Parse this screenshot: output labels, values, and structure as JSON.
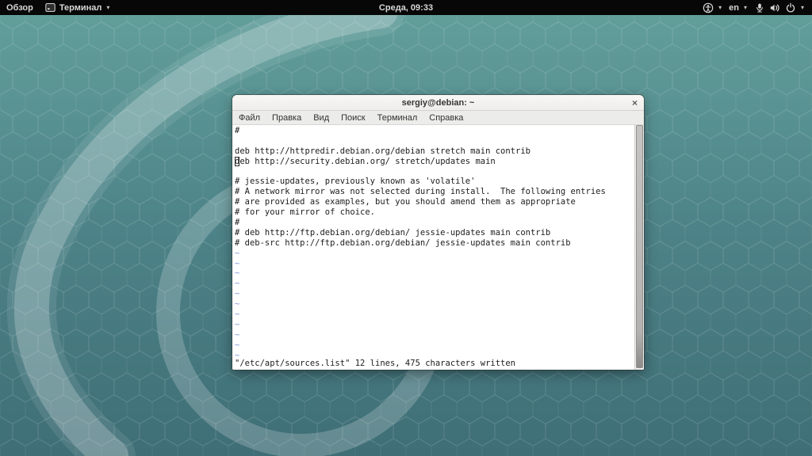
{
  "topbar": {
    "activities_label": "Обзор",
    "app_menu_label": "Терминал",
    "clock": "Среда, 09:33",
    "keyboard_layout": "en",
    "caret_glyph": "▾",
    "icons": {
      "app": "terminal-icon",
      "accessibility": "accessibility-icon",
      "microphone": "microphone-icon",
      "volume": "volume-icon",
      "power": "power-icon"
    }
  },
  "window": {
    "title": "sergiy@debian: ~",
    "close_glyph": "×",
    "menus": [
      "Файл",
      "Правка",
      "Вид",
      "Поиск",
      "Терминал",
      "Справка"
    ],
    "terminal": {
      "lines": [
        "#",
        "",
        "deb http://httpredir.debian.org/debian stretch main contrib",
        "deb http://security.debian.org/ stretch/updates main",
        "",
        "# jessie-updates, previously known as 'volatile'",
        "# A network mirror was not selected during install.  The following entries",
        "# are provided as examples, but you should amend them as appropriate",
        "# for your mirror of choice.",
        "#",
        "# deb http://ftp.debian.org/debian/ jessie-updates main contrib",
        "# deb-src http://ftp.debian.org/debian/ jessie-updates main contrib"
      ],
      "cursor": {
        "row": 3,
        "col": 0
      },
      "filler_char": "~",
      "filler_rows": 11,
      "status": "\"/etc/apt/sources.list\" 12 lines, 475 characters written"
    }
  },
  "colors": {
    "desktop_teal": "#4c8187",
    "swirl_light": "#9dc3bf",
    "topbar_bg": "#070707",
    "terminal_bg": "#ffffff",
    "terminal_fg": "#1c1c1c",
    "vim_tilde_blue": "#7d97d9"
  }
}
